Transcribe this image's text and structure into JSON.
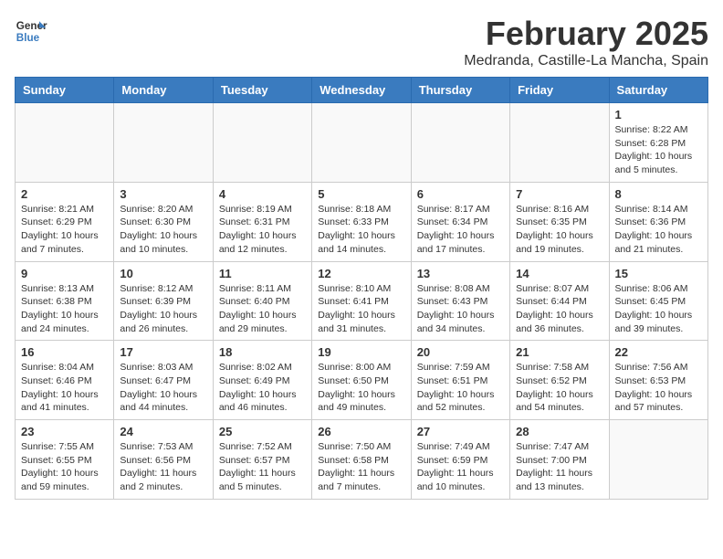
{
  "header": {
    "logo_line1": "General",
    "logo_line2": "Blue",
    "month_title": "February 2025",
    "location": "Medranda, Castille-La Mancha, Spain"
  },
  "weekdays": [
    "Sunday",
    "Monday",
    "Tuesday",
    "Wednesday",
    "Thursday",
    "Friday",
    "Saturday"
  ],
  "weeks": [
    [
      {
        "day": "",
        "info": ""
      },
      {
        "day": "",
        "info": ""
      },
      {
        "day": "",
        "info": ""
      },
      {
        "day": "",
        "info": ""
      },
      {
        "day": "",
        "info": ""
      },
      {
        "day": "",
        "info": ""
      },
      {
        "day": "1",
        "info": "Sunrise: 8:22 AM\nSunset: 6:28 PM\nDaylight: 10 hours\nand 5 minutes."
      }
    ],
    [
      {
        "day": "2",
        "info": "Sunrise: 8:21 AM\nSunset: 6:29 PM\nDaylight: 10 hours\nand 7 minutes."
      },
      {
        "day": "3",
        "info": "Sunrise: 8:20 AM\nSunset: 6:30 PM\nDaylight: 10 hours\nand 10 minutes."
      },
      {
        "day": "4",
        "info": "Sunrise: 8:19 AM\nSunset: 6:31 PM\nDaylight: 10 hours\nand 12 minutes."
      },
      {
        "day": "5",
        "info": "Sunrise: 8:18 AM\nSunset: 6:33 PM\nDaylight: 10 hours\nand 14 minutes."
      },
      {
        "day": "6",
        "info": "Sunrise: 8:17 AM\nSunset: 6:34 PM\nDaylight: 10 hours\nand 17 minutes."
      },
      {
        "day": "7",
        "info": "Sunrise: 8:16 AM\nSunset: 6:35 PM\nDaylight: 10 hours\nand 19 minutes."
      },
      {
        "day": "8",
        "info": "Sunrise: 8:14 AM\nSunset: 6:36 PM\nDaylight: 10 hours\nand 21 minutes."
      }
    ],
    [
      {
        "day": "9",
        "info": "Sunrise: 8:13 AM\nSunset: 6:38 PM\nDaylight: 10 hours\nand 24 minutes."
      },
      {
        "day": "10",
        "info": "Sunrise: 8:12 AM\nSunset: 6:39 PM\nDaylight: 10 hours\nand 26 minutes."
      },
      {
        "day": "11",
        "info": "Sunrise: 8:11 AM\nSunset: 6:40 PM\nDaylight: 10 hours\nand 29 minutes."
      },
      {
        "day": "12",
        "info": "Sunrise: 8:10 AM\nSunset: 6:41 PM\nDaylight: 10 hours\nand 31 minutes."
      },
      {
        "day": "13",
        "info": "Sunrise: 8:08 AM\nSunset: 6:43 PM\nDaylight: 10 hours\nand 34 minutes."
      },
      {
        "day": "14",
        "info": "Sunrise: 8:07 AM\nSunset: 6:44 PM\nDaylight: 10 hours\nand 36 minutes."
      },
      {
        "day": "15",
        "info": "Sunrise: 8:06 AM\nSunset: 6:45 PM\nDaylight: 10 hours\nand 39 minutes."
      }
    ],
    [
      {
        "day": "16",
        "info": "Sunrise: 8:04 AM\nSunset: 6:46 PM\nDaylight: 10 hours\nand 41 minutes."
      },
      {
        "day": "17",
        "info": "Sunrise: 8:03 AM\nSunset: 6:47 PM\nDaylight: 10 hours\nand 44 minutes."
      },
      {
        "day": "18",
        "info": "Sunrise: 8:02 AM\nSunset: 6:49 PM\nDaylight: 10 hours\nand 46 minutes."
      },
      {
        "day": "19",
        "info": "Sunrise: 8:00 AM\nSunset: 6:50 PM\nDaylight: 10 hours\nand 49 minutes."
      },
      {
        "day": "20",
        "info": "Sunrise: 7:59 AM\nSunset: 6:51 PM\nDaylight: 10 hours\nand 52 minutes."
      },
      {
        "day": "21",
        "info": "Sunrise: 7:58 AM\nSunset: 6:52 PM\nDaylight: 10 hours\nand 54 minutes."
      },
      {
        "day": "22",
        "info": "Sunrise: 7:56 AM\nSunset: 6:53 PM\nDaylight: 10 hours\nand 57 minutes."
      }
    ],
    [
      {
        "day": "23",
        "info": "Sunrise: 7:55 AM\nSunset: 6:55 PM\nDaylight: 10 hours\nand 59 minutes."
      },
      {
        "day": "24",
        "info": "Sunrise: 7:53 AM\nSunset: 6:56 PM\nDaylight: 11 hours\nand 2 minutes."
      },
      {
        "day": "25",
        "info": "Sunrise: 7:52 AM\nSunset: 6:57 PM\nDaylight: 11 hours\nand 5 minutes."
      },
      {
        "day": "26",
        "info": "Sunrise: 7:50 AM\nSunset: 6:58 PM\nDaylight: 11 hours\nand 7 minutes."
      },
      {
        "day": "27",
        "info": "Sunrise: 7:49 AM\nSunset: 6:59 PM\nDaylight: 11 hours\nand 10 minutes."
      },
      {
        "day": "28",
        "info": "Sunrise: 7:47 AM\nSunset: 7:00 PM\nDaylight: 11 hours\nand 13 minutes."
      },
      {
        "day": "",
        "info": ""
      }
    ]
  ]
}
